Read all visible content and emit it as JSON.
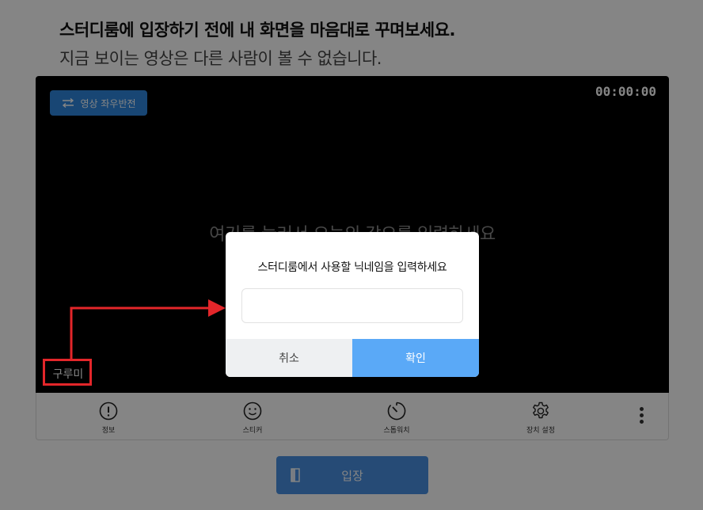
{
  "heading": {
    "line1": "스터디룸에 입장하기 전에 내 화면을 마음대로 꾸며보세요.",
    "line2": "지금 보이는 영상은 다른 사람이 볼 수 없습니다."
  },
  "video": {
    "flip_label": "영상 좌우반전",
    "timer": "00:00:00",
    "placeholder": "여기를 눌러서 오늘의 각오를 입력하세요",
    "nickname": "구루미"
  },
  "toolbar": {
    "items": [
      {
        "label": "정보",
        "icon": "info-icon"
      },
      {
        "label": "스티커",
        "icon": "smiley-icon"
      },
      {
        "label": "스톱워치",
        "icon": "stopwatch-icon"
      },
      {
        "label": "장치 설정",
        "icon": "gear-icon"
      }
    ],
    "more_icon": "more-vertical-icon"
  },
  "enter": {
    "label": "입장",
    "icon": "door-icon"
  },
  "dialog": {
    "title": "스터디룸에서 사용할 닉네임을 입력하세요",
    "input_value": "",
    "input_placeholder": "",
    "cancel_label": "취소",
    "ok_label": "확인"
  },
  "colors": {
    "accent": "#2e86de",
    "confirm": "#5aa9f7",
    "annotation": "#e3262a"
  }
}
